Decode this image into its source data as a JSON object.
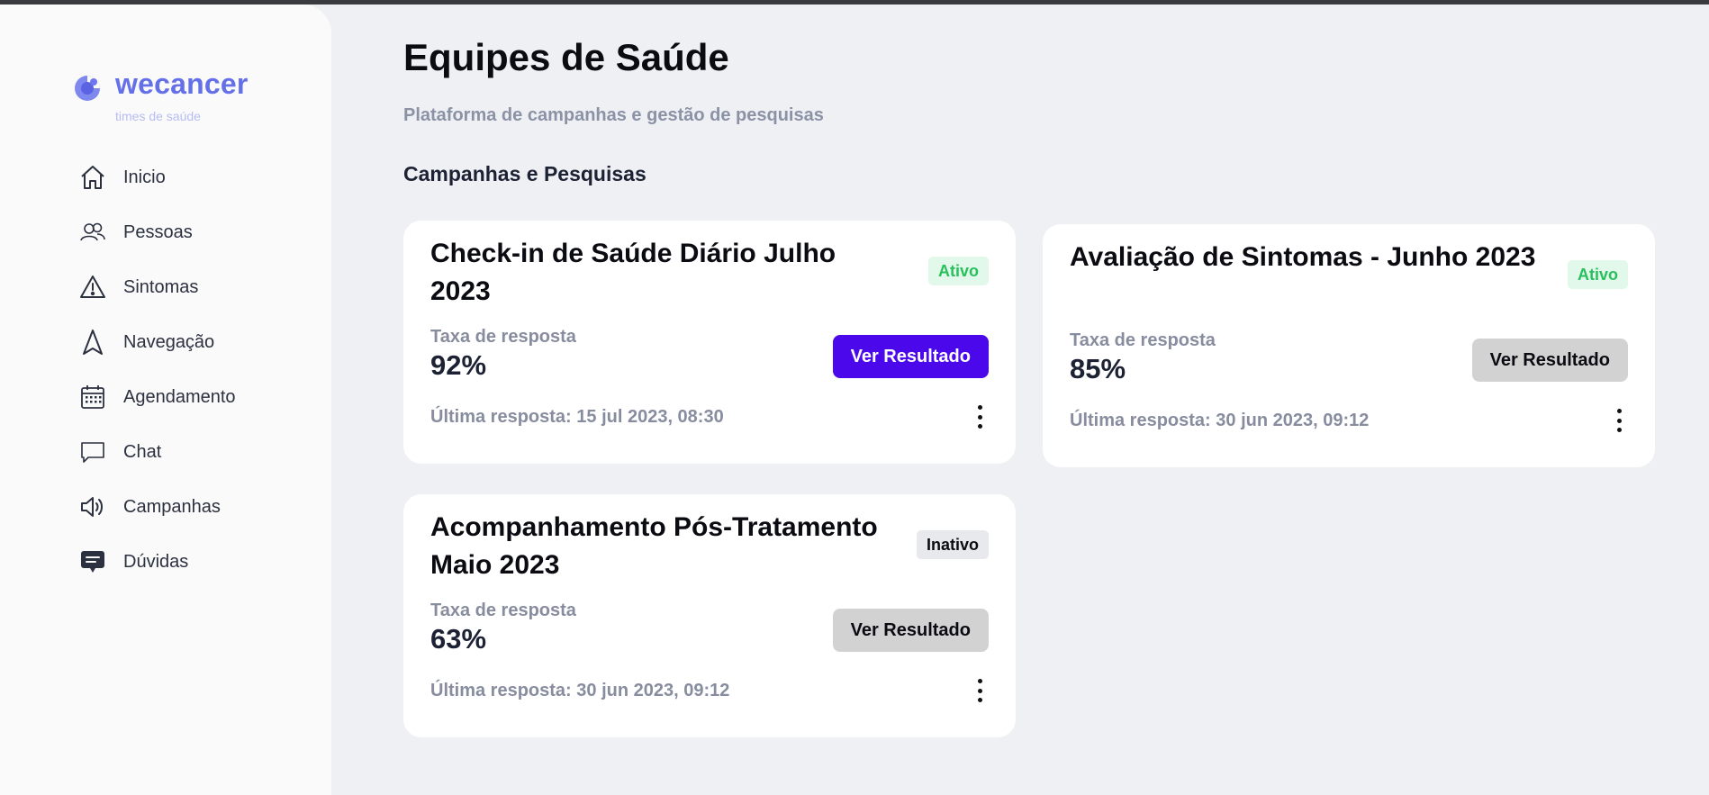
{
  "brand": {
    "name": "wecancer",
    "tagline": "times de saúde",
    "color": "#6470e8"
  },
  "sidebar": {
    "items": [
      {
        "label": "Inicio",
        "icon": "home-icon"
      },
      {
        "label": "Pessoas",
        "icon": "people-icon"
      },
      {
        "label": "Sintomas",
        "icon": "warning-icon"
      },
      {
        "label": "Navegação",
        "icon": "navigation-icon"
      },
      {
        "label": "Agendamento",
        "icon": "calendar-icon"
      },
      {
        "label": "Chat",
        "icon": "chat-icon"
      },
      {
        "label": "Campanhas",
        "icon": "megaphone-icon"
      },
      {
        "label": "Dúvidas",
        "icon": "message-icon"
      }
    ]
  },
  "header": {
    "title": "Equipes de Saúde",
    "subtitle": "Plataforma de campanhas e gestão de pesquisas"
  },
  "section": {
    "title": "Campanhas e Pesquisas"
  },
  "cards": [
    {
      "title": "Check-in de Saúde Diário Julho 2023",
      "status": "Ativo",
      "rate_label": "Taxa de resposta",
      "rate": "92%",
      "button": "Ver Resultado",
      "last_response": "Última resposta: 15 jul 2023, 08:30"
    },
    {
      "title": "Avaliação de Sintomas - Junho 2023",
      "status": "Ativo",
      "rate_label": "Taxa de resposta",
      "rate": "85%",
      "button": "Ver Resultado",
      "last_response": "Última resposta: 30 jun 2023, 09:12"
    },
    {
      "title": "Acompanhamento Pós-Tratamento Maio 2023",
      "status": "Inativo",
      "rate_label": "Taxa de resposta",
      "rate": "63%",
      "button": "Ver Resultado",
      "last_response": "Última resposta: 30 jun 2023, 09:12"
    }
  ],
  "colors": {
    "primary_button": "#4a08eb",
    "active_badge_bg": "#e2f8ea",
    "active_badge_text": "#28c05c",
    "inactive_badge_bg": "#e8e9ec",
    "background": "#eff0f4"
  }
}
